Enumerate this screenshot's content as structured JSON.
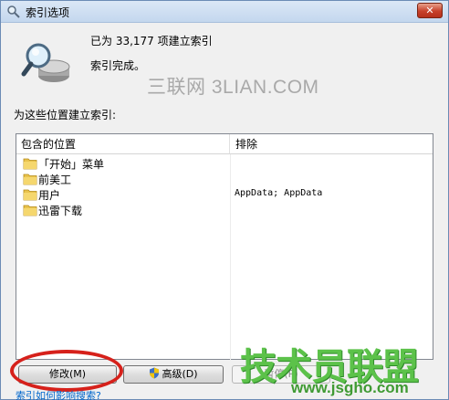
{
  "window": {
    "title": "索引选项",
    "close_glyph": "✕"
  },
  "status": {
    "count_text": "已为 33,177 项建立索引",
    "complete_text": "索引完成。"
  },
  "watermark_top": "三联网 3LIAN.COM",
  "locations": {
    "section_label": "为这些位置建立索引:",
    "header_included": "包含的位置",
    "header_excluded": "排除",
    "rows": [
      {
        "name": "「开始」菜单",
        "excluded": ""
      },
      {
        "name": "前美工",
        "excluded": ""
      },
      {
        "name": "用户",
        "excluded": "AppData; AppData"
      },
      {
        "name": "迅雷下载",
        "excluded": ""
      }
    ]
  },
  "buttons": {
    "modify": "修改(M)",
    "advanced": "高级(D)",
    "pause": "暂停(P)"
  },
  "help_link": "索引如何影响搜索?",
  "watermark_bottom": {
    "brand": "技术员联盟",
    "url": "www.jsgho.com"
  },
  "colors": {
    "annotation_circle": "#d6211b",
    "watermark_green": "#5cc24a",
    "link_blue": "#0066cc"
  }
}
